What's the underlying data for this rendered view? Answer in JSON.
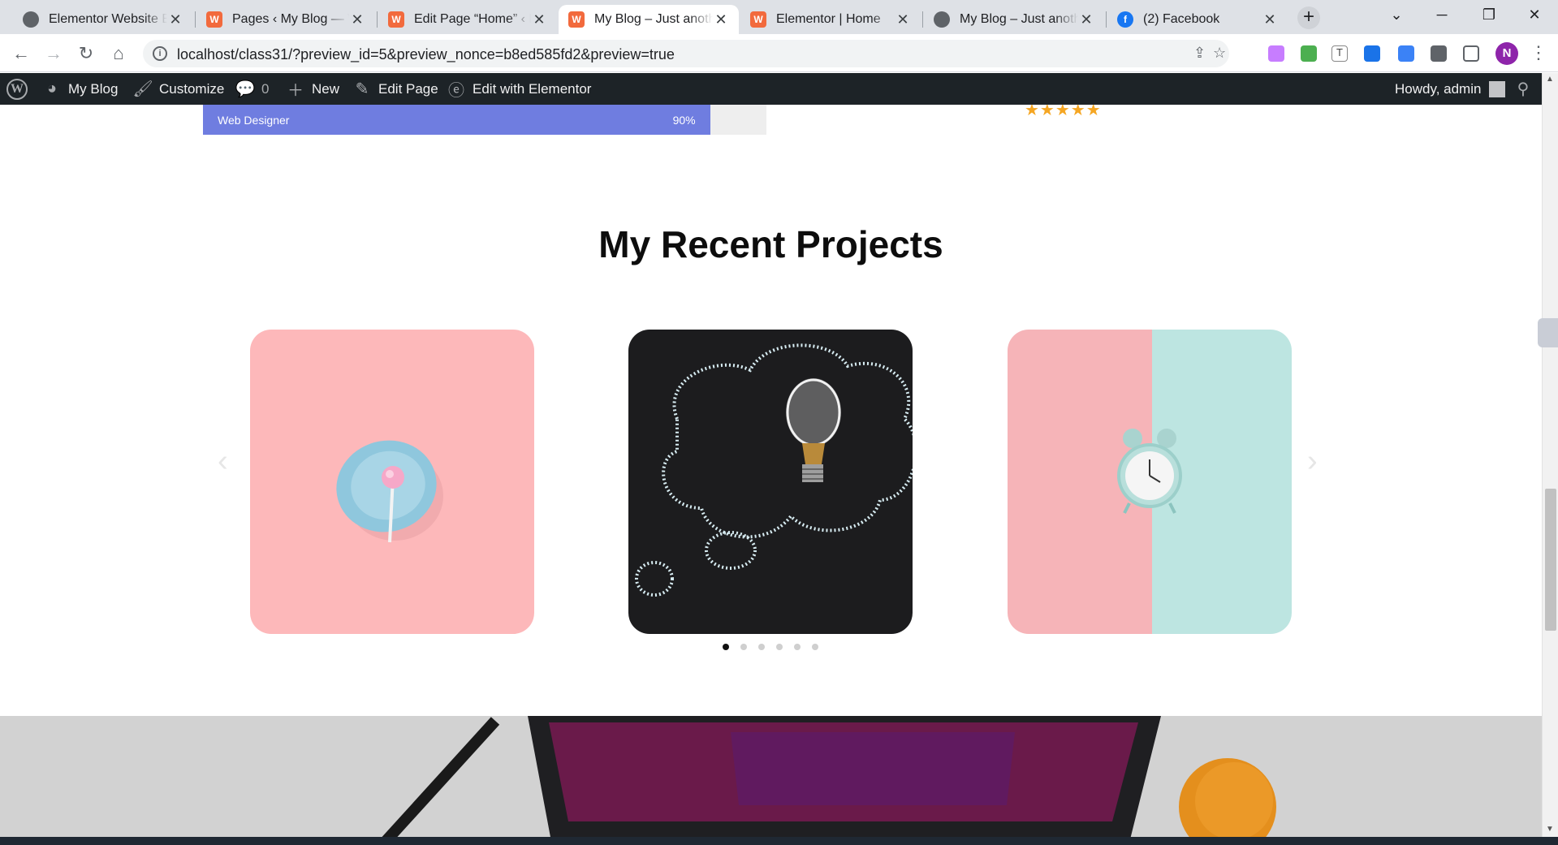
{
  "browser": {
    "tabs": [
      {
        "title": "Elementor Website Bu",
        "favicon": "globe-icon",
        "active": false
      },
      {
        "title": "Pages ‹ My Blog — W",
        "favicon": "wordpress-icon",
        "active": false
      },
      {
        "title": "Edit Page “Home” ‹ M",
        "favicon": "wordpress-icon",
        "active": false
      },
      {
        "title": "My Blog – Just anothe",
        "favicon": "wordpress-icon",
        "active": true
      },
      {
        "title": "Elementor | Home",
        "favicon": "wordpress-icon",
        "active": false
      },
      {
        "title": "My Blog – Just anothe",
        "favicon": "globe-icon",
        "active": false
      },
      {
        "title": "(2) Facebook",
        "favicon": "facebook-icon",
        "active": false
      }
    ],
    "url": "localhost/class31/?preview_id=5&preview_nonce=b8ed585fd2&preview=true",
    "profile_initial": "N"
  },
  "adminbar": {
    "site": "My Blog",
    "customize": "Customize",
    "comments": "0",
    "new": "New",
    "edit_page": "Edit Page",
    "edit_elementor": "Edit with Elementor",
    "howdy": "Howdy, admin"
  },
  "skill": {
    "label": "Web Designer",
    "percent_text": "90%",
    "percent": 0.9
  },
  "rating": {
    "stars": 5
  },
  "section": {
    "title": "My Recent Projects"
  },
  "carousel": {
    "slides": [
      "lollipop-plate",
      "lightbulb-chalk-cloud",
      "alarm-clock"
    ],
    "dot_count": 6,
    "active_dot": 0
  },
  "colors": {
    "accent": "#6f7de0",
    "adminbar": "#1d2327",
    "star": "#f5a623"
  }
}
